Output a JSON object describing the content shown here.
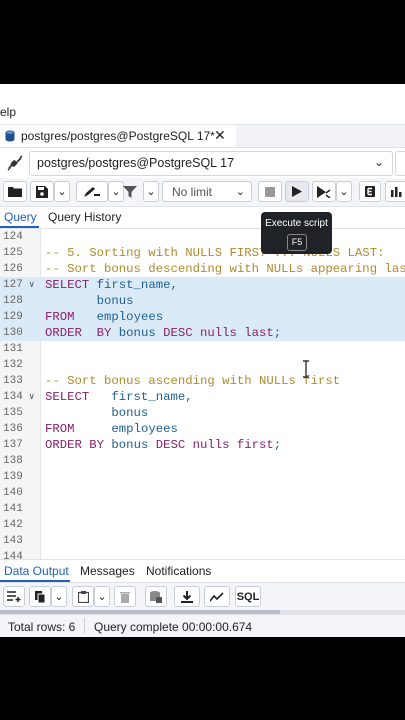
{
  "menu": {
    "help_fragment": "elp"
  },
  "tab": {
    "title": "postgres/postgres@PostgreSQL 17*",
    "close": "✕"
  },
  "connection": {
    "value": "postgres/postgres@PostgreSQL 17",
    "chevron": "⌄"
  },
  "toolbar": {
    "limit_value": "No limit",
    "buttons": [
      "open-file",
      "save",
      "save-dropdown",
      "edit",
      "edit-dropdown",
      "filter",
      "filter-dropdown",
      "limit-dropdown",
      "stop",
      "execute",
      "explain",
      "explain-dropdown",
      "explain-analyze",
      "macros"
    ]
  },
  "tooltip": {
    "label": "Execute script",
    "key": "F5"
  },
  "query_tabs": {
    "query": "Query",
    "history": "Query History"
  },
  "editor": {
    "lines": [
      {
        "n": "124",
        "segs": []
      },
      {
        "n": "125",
        "segs": [
          {
            "t": "cm",
            "v": "-- 5. Sorting with NULLS FIRST ... NULLS LAST:"
          }
        ]
      },
      {
        "n": "126",
        "segs": [
          {
            "t": "cm",
            "v": "-- Sort bonus descending with NULLs appearing last ("
          }
        ]
      },
      {
        "n": "127",
        "fold": "∨",
        "sel": true,
        "segs": [
          {
            "t": "kw",
            "v": "SELECT"
          },
          {
            "t": "id",
            "v": " first_name,"
          }
        ]
      },
      {
        "n": "128",
        "sel": true,
        "segs": [
          {
            "t": "id",
            "v": "       bonus"
          }
        ]
      },
      {
        "n": "129",
        "sel": true,
        "segs": [
          {
            "t": "kw",
            "v": "FROM"
          },
          {
            "t": "id",
            "v": "   employees"
          }
        ]
      },
      {
        "n": "130",
        "sel": true,
        "segs": [
          {
            "t": "kw",
            "v": "ORDER  BY"
          },
          {
            "t": "id",
            "v": " bonus "
          },
          {
            "t": "kw",
            "v": "DESC nulls last"
          },
          {
            "t": "id",
            "v": ";"
          }
        ]
      },
      {
        "n": "131",
        "segs": []
      },
      {
        "n": "132",
        "segs": []
      },
      {
        "n": "133",
        "segs": [
          {
            "t": "cm",
            "v": "-- Sort bonus ascending with NULLs first"
          }
        ]
      },
      {
        "n": "134",
        "fold": "∨",
        "segs": [
          {
            "t": "kw",
            "v": "SELECT"
          },
          {
            "t": "id",
            "v": "   first_name,"
          }
        ]
      },
      {
        "n": "135",
        "segs": [
          {
            "t": "id",
            "v": "         bonus"
          }
        ]
      },
      {
        "n": "136",
        "segs": [
          {
            "t": "kw",
            "v": "FROM"
          },
          {
            "t": "id",
            "v": "     employees"
          }
        ]
      },
      {
        "n": "137",
        "segs": [
          {
            "t": "kw",
            "v": "ORDER BY"
          },
          {
            "t": "id",
            "v": " bonus "
          },
          {
            "t": "kw",
            "v": "DESC nulls first"
          },
          {
            "t": "id",
            "v": ";"
          }
        ]
      },
      {
        "n": "138",
        "segs": []
      },
      {
        "n": "139",
        "segs": []
      },
      {
        "n": "140",
        "segs": []
      },
      {
        "n": "141",
        "segs": []
      },
      {
        "n": "142",
        "segs": []
      },
      {
        "n": "143",
        "segs": []
      },
      {
        "n": "144",
        "segs": []
      }
    ]
  },
  "panel": {
    "tabs": {
      "data": "Data Output",
      "messages": "Messages",
      "notifications": "Notifications"
    },
    "sql_label": "SQL"
  },
  "status": {
    "rows": "Total rows: 6",
    "message": "Query complete 00:00:00.674"
  },
  "colors": {
    "accent": "#1f5fbf",
    "selection": "#dbeaf7",
    "keyword": "#8a1f6a",
    "comment": "#b08a2e"
  }
}
